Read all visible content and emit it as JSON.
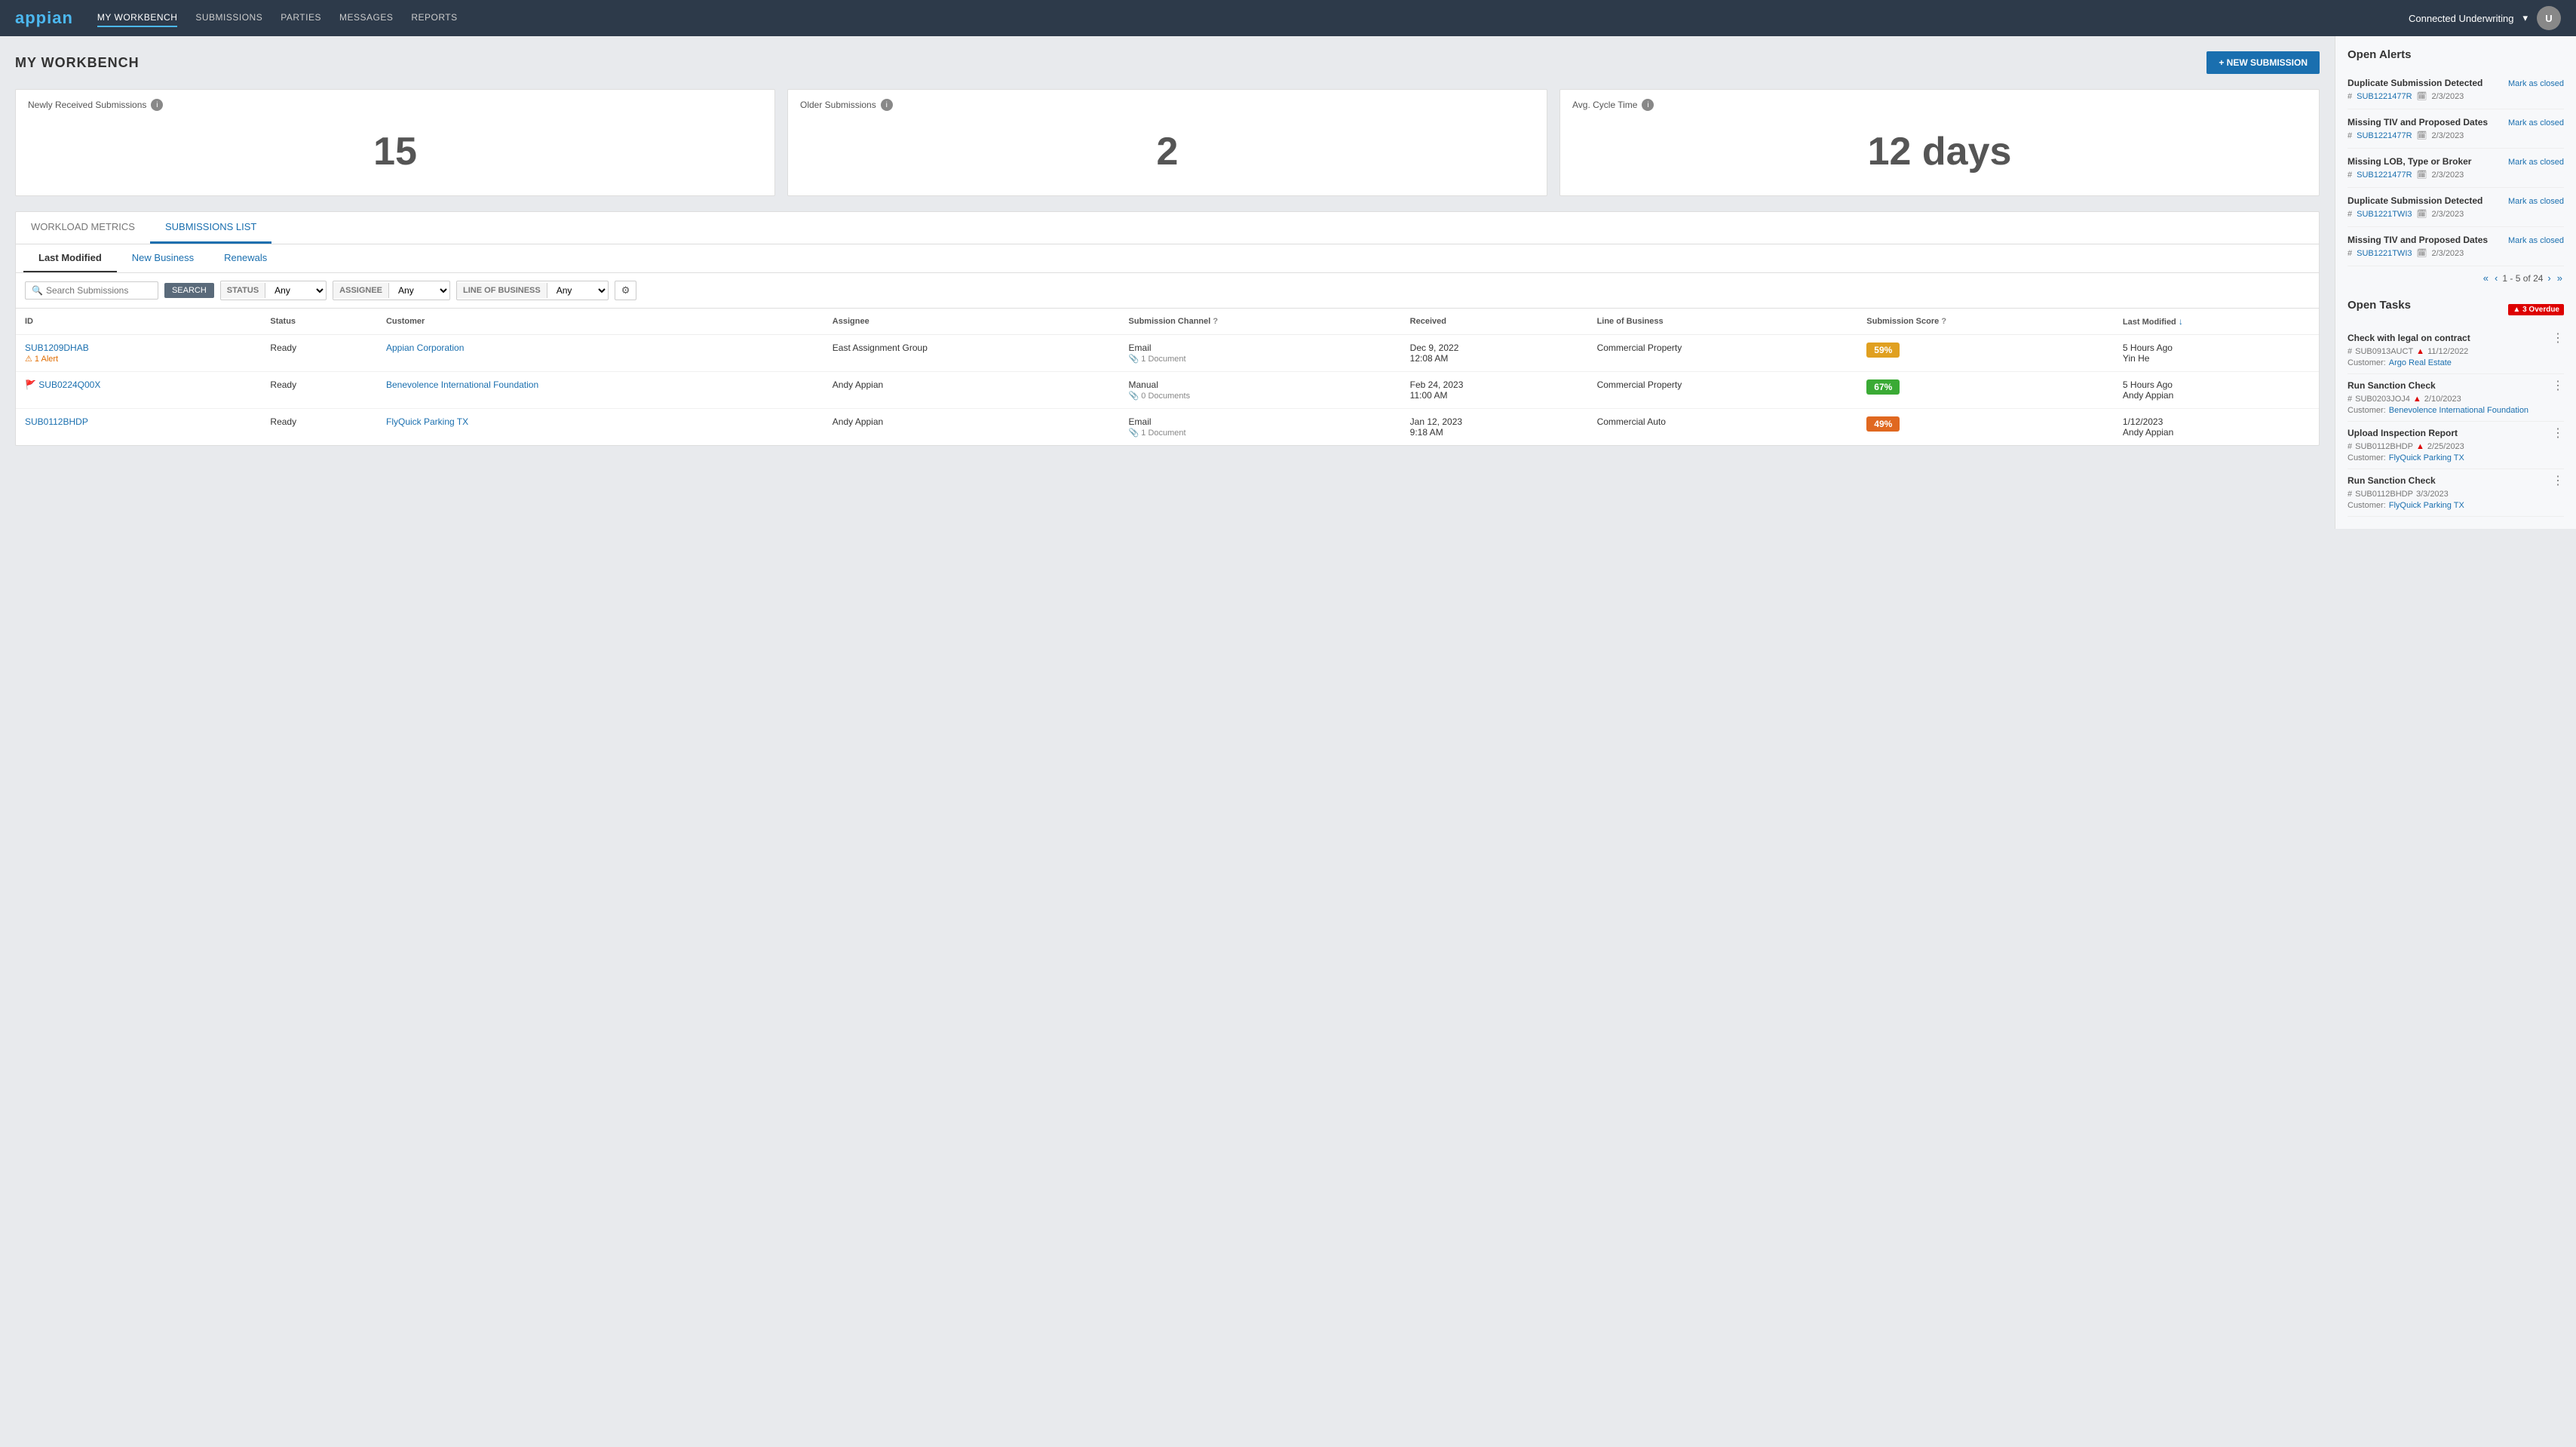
{
  "app": {
    "logo": "appian",
    "name": "Connected Underwriting"
  },
  "nav": {
    "items": [
      {
        "id": "my-workbench",
        "label": "MY WORKBENCH",
        "active": true
      },
      {
        "id": "submissions",
        "label": "SUBMISSIONS",
        "active": false
      },
      {
        "id": "parties",
        "label": "PARTIES",
        "active": false
      },
      {
        "id": "messages",
        "label": "MESSAGES",
        "active": false
      },
      {
        "id": "reports",
        "label": "REPORTS",
        "active": false
      }
    ],
    "dropdown_icon": "▾"
  },
  "page": {
    "title": "MY WORKBENCH",
    "new_submission_label": "+ NEW SUBMISSION"
  },
  "metrics": {
    "newly_received": {
      "label": "Newly Received Submissions",
      "value": "15"
    },
    "older": {
      "label": "Older Submissions",
      "value": "2"
    },
    "avg_cycle": {
      "label": "Avg. Cycle Time",
      "value": "12 days"
    }
  },
  "main_tabs": [
    {
      "id": "workload",
      "label": "WORKLOAD METRICS",
      "active": false
    },
    {
      "id": "submissions-list",
      "label": "SUBMISSIONS LIST",
      "active": true
    }
  ],
  "sub_tabs": [
    {
      "id": "last-modified",
      "label": "Last Modified",
      "active": true
    },
    {
      "id": "new-business",
      "label": "New Business",
      "active": false,
      "color": "blue"
    },
    {
      "id": "renewals",
      "label": "Renewals",
      "active": false,
      "color": "blue"
    }
  ],
  "filters": {
    "search_placeholder": "Search Submissions",
    "search_button": "SEARCH",
    "status_label": "STATUS",
    "status_value": "Any",
    "assignee_label": "ASSIGNEE",
    "assignee_value": "Any",
    "lob_label": "LINE OF BUSINESS",
    "lob_value": "Any"
  },
  "table": {
    "columns": [
      {
        "id": "id",
        "label": "ID"
      },
      {
        "id": "status",
        "label": "Status"
      },
      {
        "id": "customer",
        "label": "Customer"
      },
      {
        "id": "assignee",
        "label": "Assignee"
      },
      {
        "id": "channel",
        "label": "Submission Channel"
      },
      {
        "id": "received",
        "label": "Received"
      },
      {
        "id": "lob",
        "label": "Line of Business"
      },
      {
        "id": "score",
        "label": "Submission Score",
        "has_help": true
      },
      {
        "id": "last-modified",
        "label": "Last Modified",
        "sort": "desc"
      }
    ],
    "rows": [
      {
        "id": "SUB1209DHAB",
        "id_flag": "alert",
        "alert_text": "1 Alert",
        "status": "Ready",
        "customer": "Appian Corporation",
        "customer_link": true,
        "assignee": "East Assignment Group",
        "channel": "Email",
        "channel_docs": "1 Document",
        "received_date": "Dec 9, 2022",
        "received_time": "12:08 AM",
        "lob": "Commercial Property",
        "score": "59%",
        "score_color": "yellow",
        "last_modified": "5 Hours Ago",
        "last_modified_by": "Yin He"
      },
      {
        "id": "SUB0224Q00X",
        "id_flag": "flag",
        "alert_text": "",
        "status": "Ready",
        "customer": "Benevolence International Foundation",
        "customer_link": true,
        "assignee": "Andy Appian",
        "channel": "Manual",
        "channel_docs": "0 Documents",
        "received_date": "Feb 24, 2023",
        "received_time": "11:00 AM",
        "lob": "Commercial Property",
        "score": "67%",
        "score_color": "green",
        "last_modified": "5 Hours Ago",
        "last_modified_by": "Andy Appian"
      },
      {
        "id": "SUB0112BHDP",
        "id_flag": "none",
        "alert_text": "",
        "status": "Ready",
        "customer": "FlyQuick Parking TX",
        "customer_link": true,
        "assignee": "Andy Appian",
        "channel": "Email",
        "channel_docs": "1 Document",
        "received_date": "Jan 12, 2023",
        "received_time": "9:18 AM",
        "lob": "Commercial Auto",
        "score": "49%",
        "score_color": "orange",
        "last_modified": "1/12/2023",
        "last_modified_by": "Andy Appian"
      }
    ]
  },
  "open_alerts": {
    "title": "Open Alerts",
    "items": [
      {
        "title": "Duplicate Submission Detected",
        "sub_id": "SUB1221477R",
        "date": "2/3/2023",
        "close_label": "Mark as closed"
      },
      {
        "title": "Missing TIV and Proposed Dates",
        "sub_id": "SUB1221477R",
        "date": "2/3/2023",
        "close_label": "Mark as closed"
      },
      {
        "title": "Missing LOB, Type or Broker",
        "sub_id": "SUB1221477R",
        "date": "2/3/2023",
        "close_label": "Mark as closed"
      },
      {
        "title": "Duplicate Submission Detected",
        "sub_id": "SUB1221TWI3",
        "date": "2/3/2023",
        "close_label": "Mark as closed"
      },
      {
        "title": "Missing TIV and Proposed Dates",
        "sub_id": "SUB1221TWI3",
        "date": "2/3/2023",
        "close_label": "Mark as closed"
      }
    ],
    "pagination": "1 - 5 of 24"
  },
  "open_tasks": {
    "title": "Open Tasks",
    "overdue_label": "3 Overdue",
    "items": [
      {
        "title": "Check with legal on contract",
        "sub_id": "SUB0913AUCT",
        "date": "11/12/2022",
        "date_alert": true,
        "customer_label": "Customer:",
        "customer": "Argo Real Estate",
        "customer_link": true
      },
      {
        "title": "Run Sanction Check",
        "sub_id": "SUB0203JOJ4",
        "date": "2/10/2023",
        "date_alert": true,
        "customer_label": "Customer:",
        "customer": "Benevolence International Foundation",
        "customer_link": true
      },
      {
        "title": "Upload Inspection Report",
        "sub_id": "SUB0112BHDP",
        "date": "2/25/2023",
        "date_alert": true,
        "customer_label": "Customer:",
        "customer": "FlyQuick Parking TX",
        "customer_link": true
      },
      {
        "title": "Run Sanction Check",
        "sub_id": "SUB0112BHDP",
        "date": "3/3/2023",
        "date_alert": false,
        "customer_label": "Customer:",
        "customer": "FlyQuick Parking TX",
        "customer_link": true
      }
    ]
  }
}
